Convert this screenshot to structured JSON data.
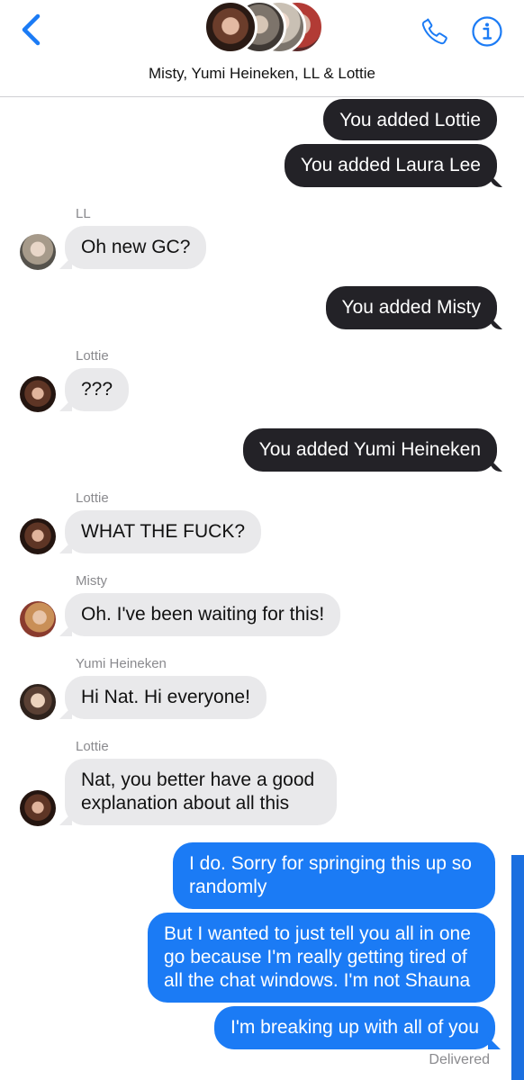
{
  "header": {
    "title": "Misty, Yumi Heineken, LL & Lottie",
    "back_icon": "chevron-left-icon",
    "call_icon": "phone-icon",
    "info_icon": "info-icon"
  },
  "colors": {
    "accent": "#1b7bf5",
    "system_bubble": "#232227",
    "incoming_bubble": "#e9e9eb",
    "meta_text": "#8a8a8e"
  },
  "messages": [
    {
      "type": "system",
      "text": "You added Lottie"
    },
    {
      "type": "system",
      "text": "You added Laura Lee"
    },
    {
      "type": "incoming",
      "sender": "LL",
      "text": "Oh new GC?"
    },
    {
      "type": "system",
      "text": "You added Misty"
    },
    {
      "type": "incoming",
      "sender": "Lottie",
      "text": "???"
    },
    {
      "type": "system",
      "text": "You added Yumi Heineken"
    },
    {
      "type": "incoming",
      "sender": "Lottie",
      "text": "WHAT THE FUCK?"
    },
    {
      "type": "incoming",
      "sender": "Misty",
      "text": "Oh. I've been waiting for this!"
    },
    {
      "type": "incoming",
      "sender": "Yumi Heineken",
      "text": "Hi Nat. Hi everyone!"
    },
    {
      "type": "incoming",
      "sender": "Lottie",
      "text": "Nat, you better have a good explanation about all this"
    },
    {
      "type": "outgoing",
      "text": "I do. Sorry for springing this up so randomly"
    },
    {
      "type": "outgoing",
      "text": "But I wanted to just tell you all in one go because I'm really getting tired of all the chat windows. I'm not Shauna"
    },
    {
      "type": "outgoing",
      "text": "I'm breaking up with all of you"
    }
  ],
  "status": "Delivered"
}
